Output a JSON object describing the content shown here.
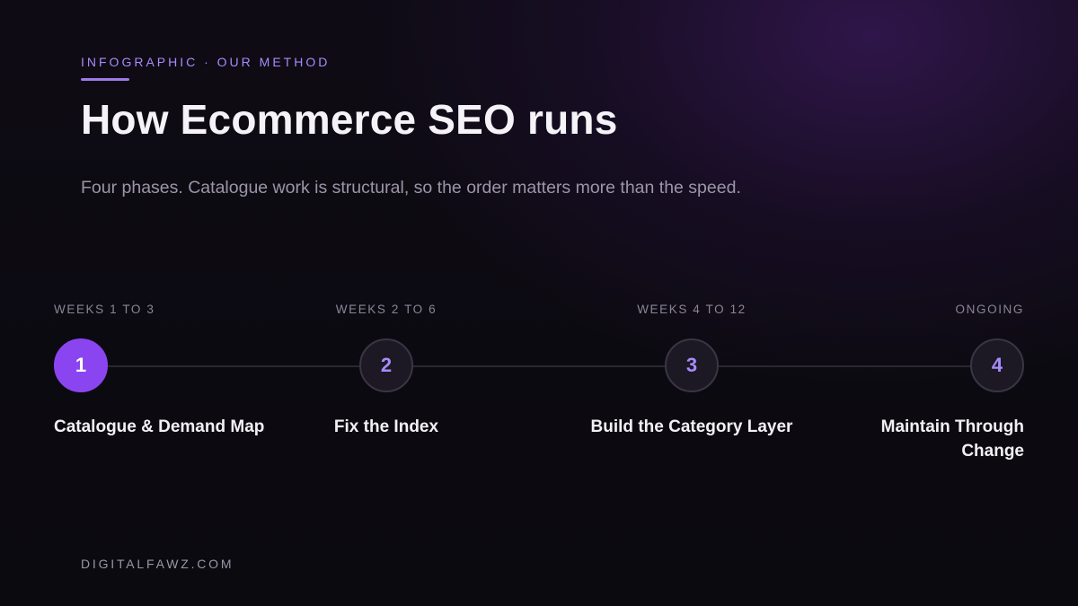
{
  "header": {
    "eyebrow": "INFOGRAPHIC · OUR METHOD",
    "title": "How Ecommerce SEO runs",
    "subtitle": "Four phases. Catalogue work is structural, so the order matters more than the speed."
  },
  "phases": [
    {
      "number": "1",
      "weeks": "WEEKS 1 TO 3",
      "label": "Catalogue & Demand Map",
      "active": true
    },
    {
      "number": "2",
      "weeks": "WEEKS 2 TO 6",
      "label": "Fix the Index",
      "active": false
    },
    {
      "number": "3",
      "weeks": "WEEKS 4 TO 12",
      "label": "Build the Category Layer",
      "active": false
    },
    {
      "number": "4",
      "weeks": "ONGOING",
      "label": "Maintain Through Change",
      "active": false
    }
  ],
  "footer": {
    "brand": "DIGITALFAWZ.COM"
  },
  "colors": {
    "accent": "#8b45f0",
    "eyebrow": "#a78bfa",
    "background": "#0d0a12"
  }
}
